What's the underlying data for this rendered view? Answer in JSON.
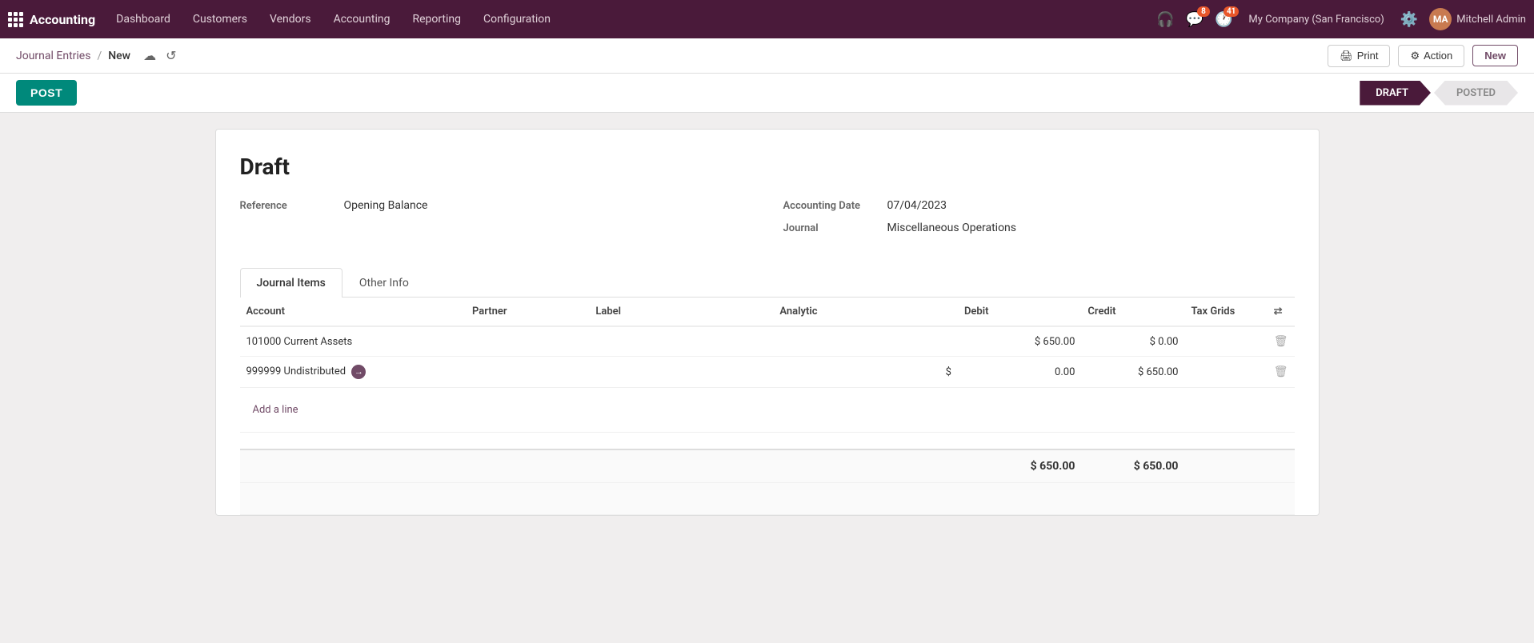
{
  "app": {
    "name": "Accounting"
  },
  "topnav": {
    "brand": "Accounting",
    "items": [
      {
        "label": "Dashboard",
        "id": "dashboard"
      },
      {
        "label": "Customers",
        "id": "customers"
      },
      {
        "label": "Vendors",
        "id": "vendors"
      },
      {
        "label": "Accounting",
        "id": "accounting"
      },
      {
        "label": "Reporting",
        "id": "reporting"
      },
      {
        "label": "Configuration",
        "id": "configuration"
      }
    ],
    "notification_count": "8",
    "activity_count": "41",
    "company": "My Company (San Francisco)",
    "user": "Mitchell Admin"
  },
  "breadcrumb": {
    "parent": "Journal Entries",
    "separator": "/",
    "current": "New"
  },
  "toolbar": {
    "print_label": "Print",
    "action_label": "Action",
    "new_label": "New"
  },
  "status": {
    "post_label": "POST",
    "steps": [
      {
        "label": "DRAFT",
        "id": "draft",
        "active": true
      },
      {
        "label": "POSTED",
        "id": "posted",
        "active": false
      }
    ]
  },
  "form": {
    "title": "Draft",
    "reference_label": "Reference",
    "reference_value": "Opening Balance",
    "accounting_date_label": "Accounting Date",
    "accounting_date_value": "07/04/2023",
    "journal_label": "Journal",
    "journal_value": "Miscellaneous Operations"
  },
  "tabs": [
    {
      "label": "Journal Items",
      "id": "journal-items",
      "active": true
    },
    {
      "label": "Other Info",
      "id": "other-info",
      "active": false
    }
  ],
  "table": {
    "headers": {
      "account": "Account",
      "partner": "Partner",
      "label": "Label",
      "analytic": "Analytic",
      "debit": "Debit",
      "credit": "Credit",
      "tax_grids": "Tax Grids"
    },
    "rows": [
      {
        "account": "101000 Current Assets",
        "partner": "",
        "label": "",
        "analytic": "",
        "debit": "$ 650.00",
        "credit": "$ 0.00",
        "tax_grids": "",
        "has_arrow": false
      },
      {
        "account": "999999 Undistributed",
        "partner": "",
        "label": "",
        "analytic": "",
        "debit_prefix": "$",
        "debit_value": "0.00",
        "credit_prefix": "$",
        "credit_value": "650.00",
        "tax_grids": "",
        "has_arrow": true
      }
    ],
    "add_line_label": "Add a line",
    "totals": {
      "debit": "$ 650.00",
      "credit": "$ 650.00"
    }
  }
}
